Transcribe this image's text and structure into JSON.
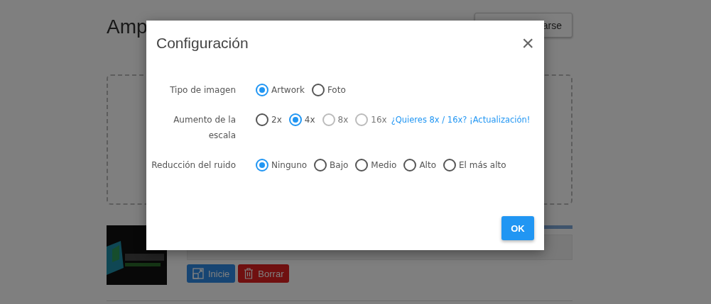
{
  "page": {
    "title": "Amp",
    "top_button": "arse",
    "start_button": "Inicie",
    "delete_button": "Borrar",
    "progress": {
      "level": 1
    }
  },
  "dialog": {
    "title": "Configuración",
    "close": "×",
    "settings": [
      {
        "label": "Tipo de imagen",
        "options": [
          {
            "label": "Artwork",
            "selected": true,
            "disabled": false
          },
          {
            "label": "Foto",
            "selected": false,
            "disabled": false
          }
        ]
      },
      {
        "label": "Aumento de la escala",
        "options": [
          {
            "label": "2x",
            "selected": false,
            "disabled": false
          },
          {
            "label": "4x",
            "selected": true,
            "disabled": false
          },
          {
            "label": "8x",
            "selected": false,
            "disabled": true
          },
          {
            "label": "16x",
            "selected": false,
            "disabled": true
          }
        ],
        "link": "¿Quieres 8x / 16x? ¡Actualización!"
      },
      {
        "label": "Reducción del ruido",
        "options": [
          {
            "label": "Ninguno",
            "selected": true,
            "disabled": false
          },
          {
            "label": "Bajo",
            "selected": false,
            "disabled": false
          },
          {
            "label": "Medio",
            "selected": false,
            "disabled": false
          },
          {
            "label": "Alto",
            "selected": false,
            "disabled": false
          },
          {
            "label": "El más alto",
            "selected": false,
            "disabled": false
          }
        ]
      }
    ],
    "ok": "OK"
  }
}
